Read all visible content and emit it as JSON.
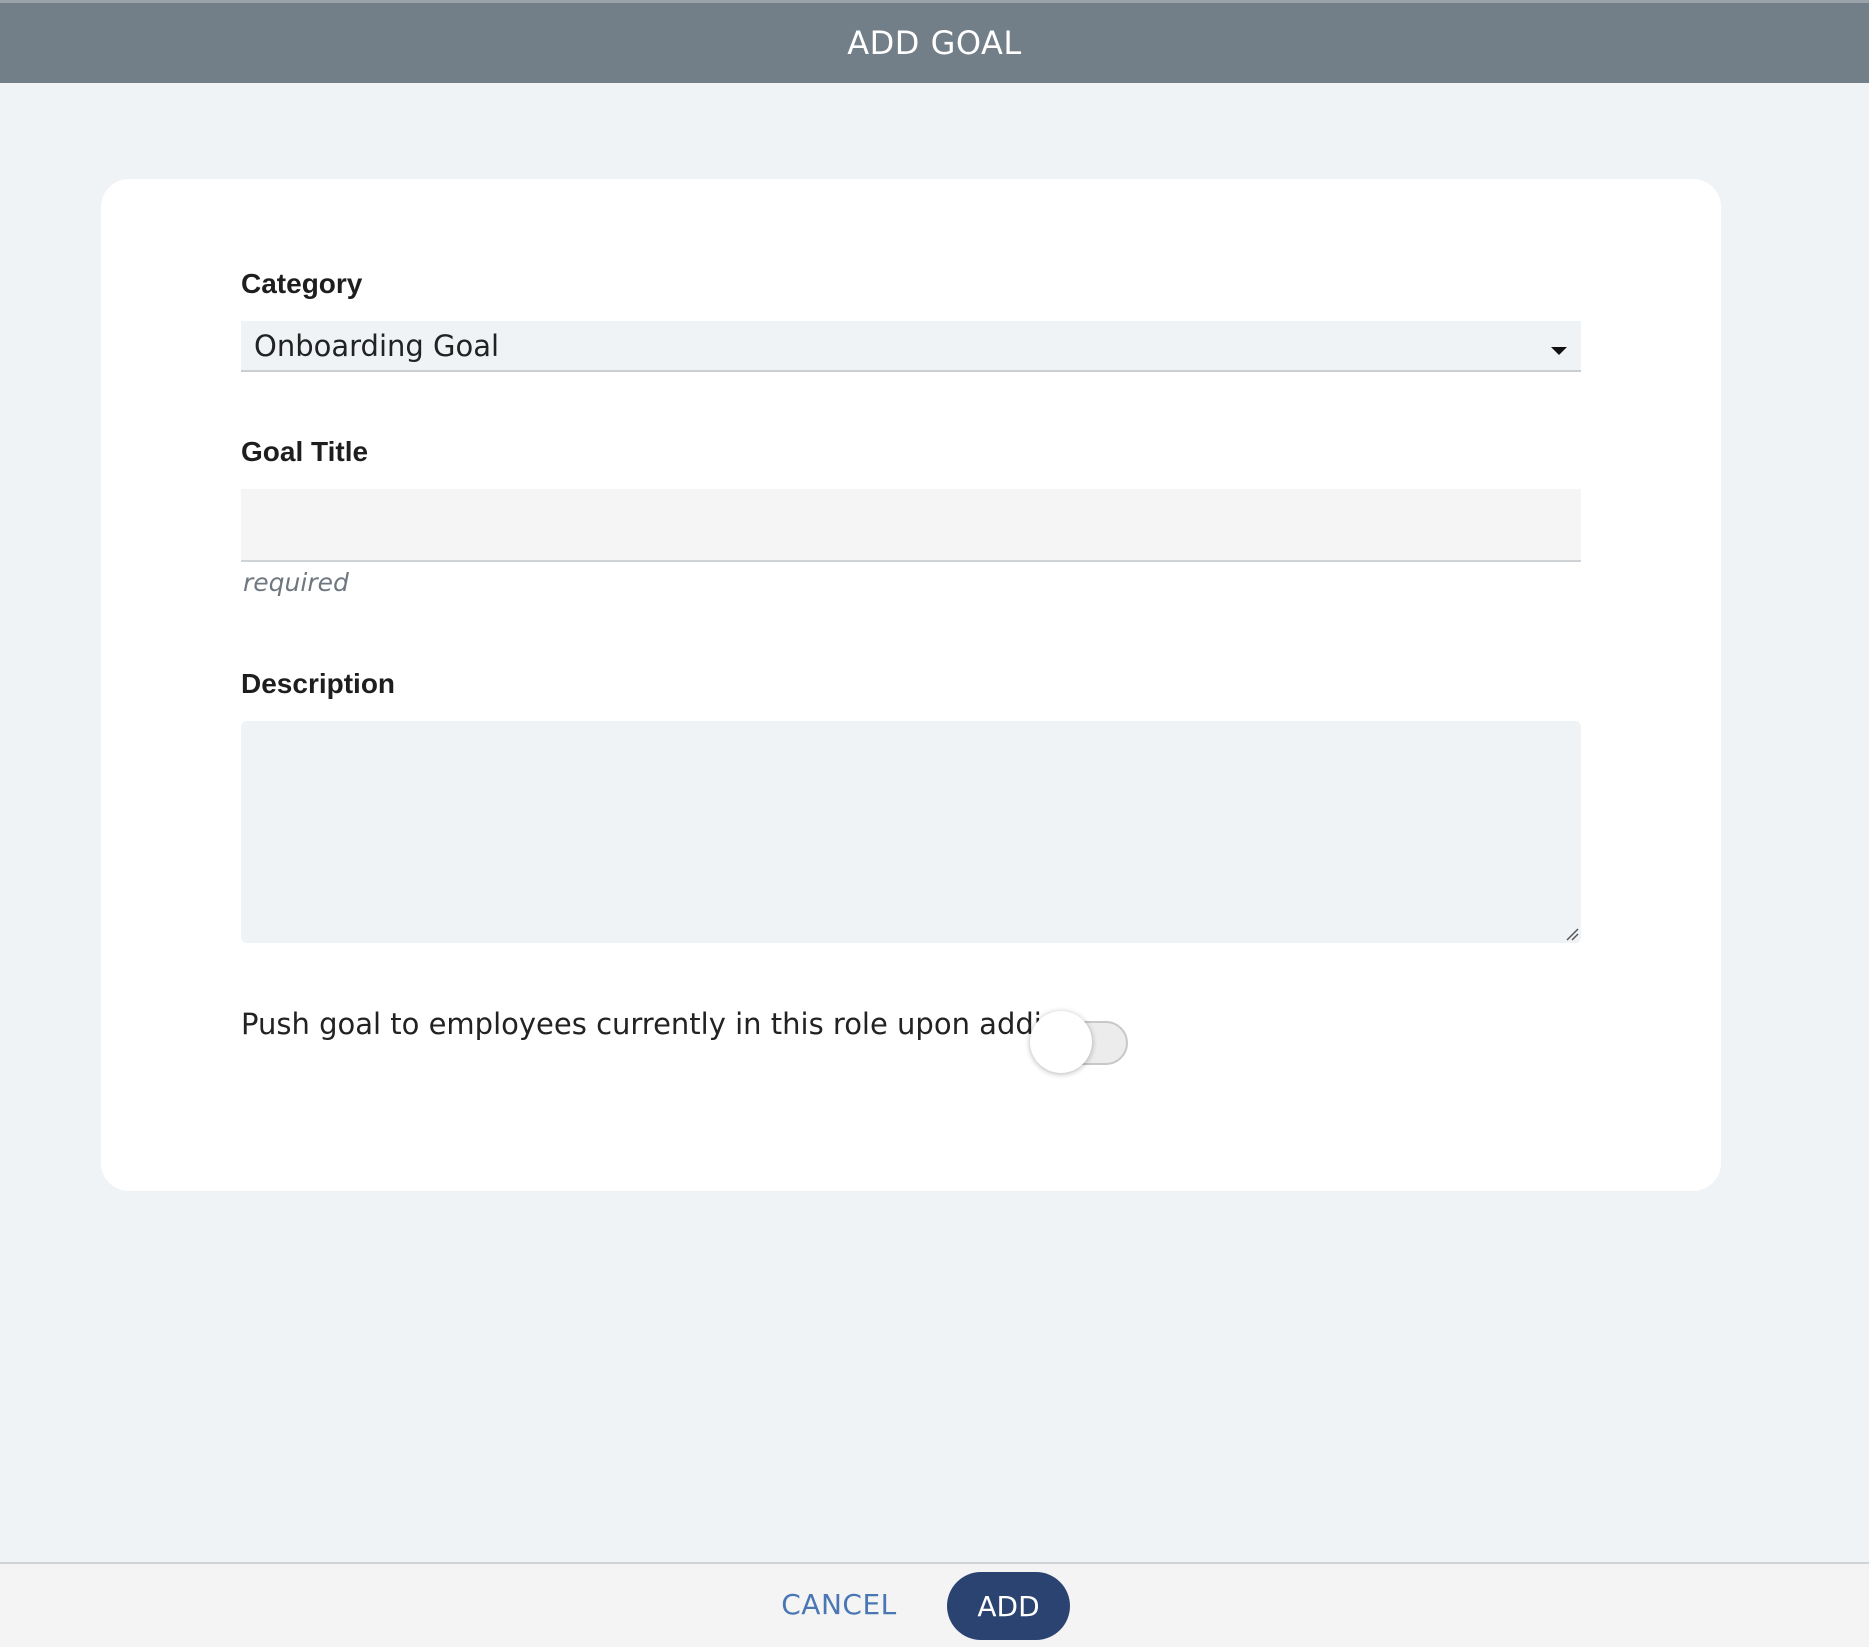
{
  "dialog": {
    "title": "ADD GOAL"
  },
  "form": {
    "category": {
      "label": "Category",
      "selected_value": "Onboarding Goal"
    },
    "goal_title": {
      "label": "Goal Title",
      "value": "",
      "helper_text": "required"
    },
    "description": {
      "label": "Description",
      "value": ""
    },
    "push_toggle": {
      "label": "Push goal to employees currently in this role upon adding",
      "checked": false
    }
  },
  "footer": {
    "cancel_label": "CANCEL",
    "add_label": "ADD"
  },
  "colors": {
    "header_bg": "#737f88",
    "page_bg": "#eff3f6",
    "primary_button": "#2b4371",
    "link_text": "#4a77b4"
  }
}
